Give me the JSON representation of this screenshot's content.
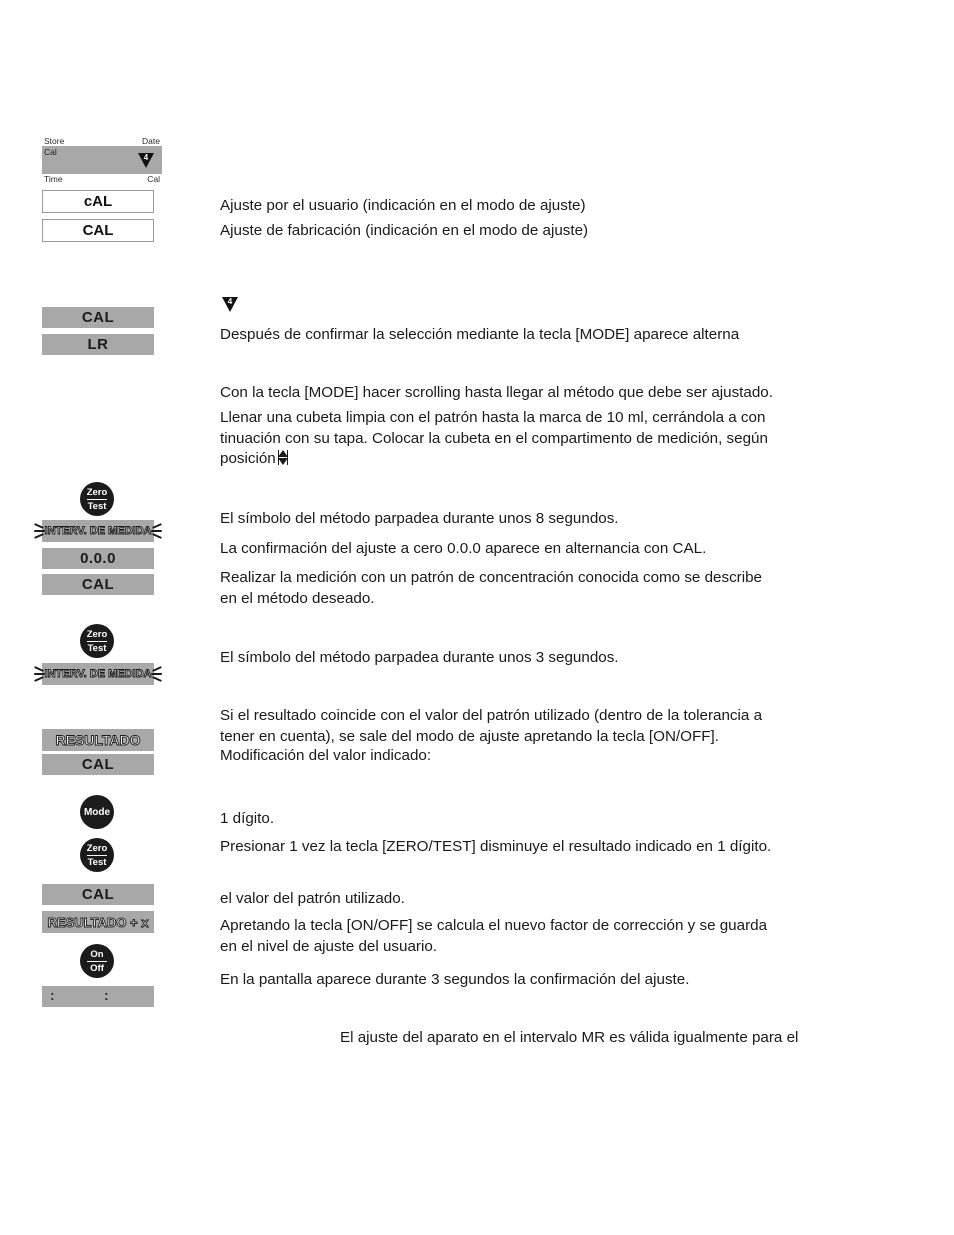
{
  "document": {
    "language": "es",
    "page_background": "#ffffff",
    "lcd_background": "#a8a8a8",
    "key_background": "#1b1b1b",
    "text_color": "#1a1a1a"
  },
  "displays": {
    "store_date_display": {
      "label_store": "Store",
      "label_date": "Date",
      "label_cal": "Cal",
      "label_time": "Time",
      "label_cal_right": "Cal",
      "marker_number": "4"
    },
    "user_cal_box": "cAL",
    "factory_cal_box": "CAL",
    "cal_bar_1": "CAL",
    "lr_bar": "LR",
    "interval_bar_1": "INTERV. DE MEDIDA",
    "zero_value_bar": "0.0.0",
    "cal_bar_2": "CAL",
    "interval_bar_2": "INTERV. DE MEDIDA",
    "resultado_bar": "RESULTADO",
    "cal_bar_3": "CAL",
    "cal_bar_4": "CAL",
    "resultado_plus_bar": "RESULTADO + x",
    "colon_bar": {
      "left": ":",
      "right": ":"
    }
  },
  "keys": {
    "zero_test_1": {
      "top": "Zero",
      "bottom": "Test"
    },
    "zero_test_2": {
      "top": "Zero",
      "bottom": "Test"
    },
    "mode": {
      "label": "Mode"
    },
    "zero_test_3": {
      "top": "Zero",
      "bottom": "Test"
    },
    "on_off": {
      "top": "On",
      "bottom": "Off"
    }
  },
  "body": {
    "p_user_adjust": "Ajuste por el usuario (indicación en el modo de ajuste)",
    "p_factory_adjust": "Ajuste de fabricación (indicación en el modo de ajuste)",
    "marker_number_inline": "4",
    "p_after_confirm": "Después de confirmar la selección mediante la tecla [MODE] aparece alterna",
    "p_scroll_mode": "Con la tecla [MODE] hacer scrolling hasta llegar al método que debe ser ajustado.",
    "p_fill_cuvette_line1": "Llenar una cubeta limpia con el patrón hasta la marca de 10 ml, cerrándola a con",
    "p_fill_cuvette_line2": "tinuación con su tapa. Colocar la cubeta en el compartimento de medición, según",
    "p_fill_cuvette_line3": "posición",
    "p_blink_8s": "El símbolo del método parpadea durante unos 8 segundos.",
    "p_zero_confirm": "La confirmación del ajuste a cero 0.0.0 aparece en alternancia con CAL.",
    "p_measure_standard_line1": "Realizar la medición con un patrón de concentración conocida como se describe",
    "p_measure_standard_line2": "en el método deseado.",
    "p_blink_3s": "El símbolo del método parpadea durante unos 3 segundos.",
    "p_result_match_line1": "Si el resultado coincide con el valor del patrón utilizado (dentro de la tolerancia a",
    "p_result_match_line2": "tener en cuenta), se sale del modo de ajuste apretando la tecla [ON/OFF].",
    "p_modify_value": "Modificación del valor indicado:",
    "p_one_digit": "1 dígito.",
    "p_press_zero_test": "Presionar 1 vez la tecla [ZERO/TEST] disminuye el resultado indicado en 1 dígito.",
    "p_standard_value": "el valor del patrón utilizado.",
    "p_on_off_calc_line1": "Apretando la tecla [ON/OFF] se calcula el nuevo factor de corrección y se guarda",
    "p_on_off_calc_line2": "en el nivel de ajuste del usuario.",
    "p_screen_3s": "En la pantalla aparece durante 3 segundos la confirmación del ajuste.",
    "p_mr_note": "El ajuste del aparato en el intervalo MR es válida igualmente para el"
  }
}
